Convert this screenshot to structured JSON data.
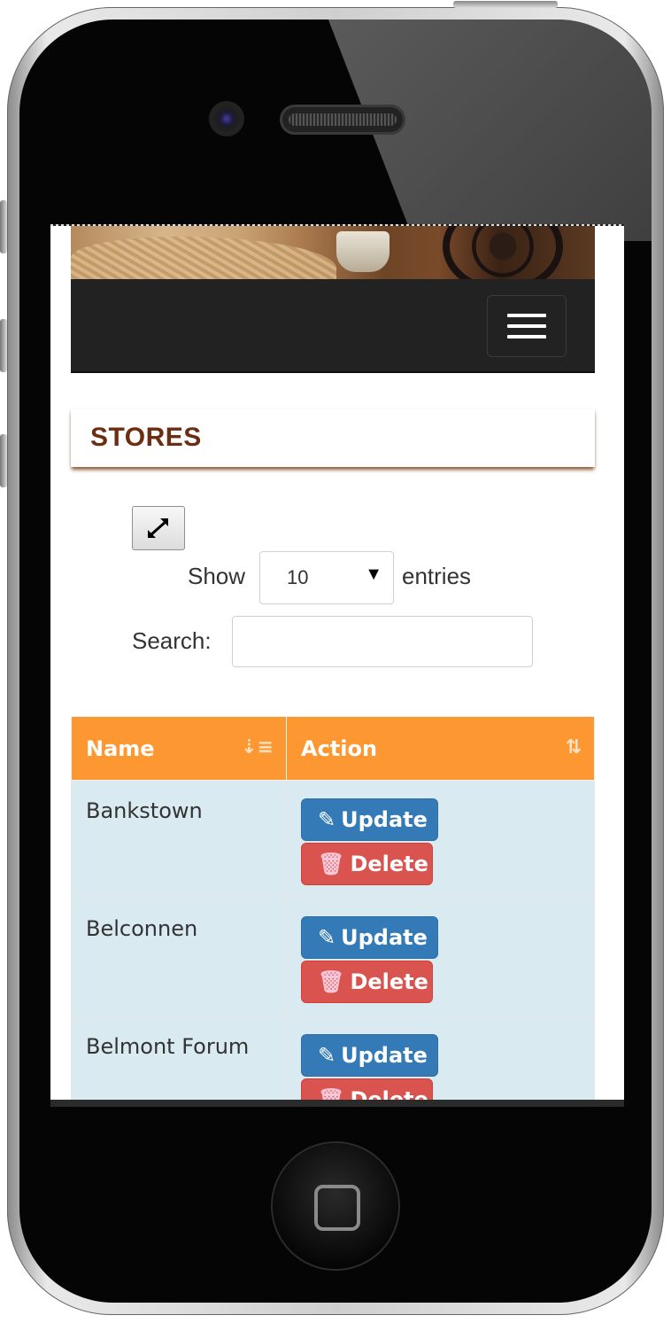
{
  "section": {
    "title": "STORES"
  },
  "length": {
    "show_label": "Show",
    "selected": "10",
    "entries_label": "entries"
  },
  "search": {
    "label": "Search:",
    "value": "",
    "placeholder": ""
  },
  "table": {
    "columns": [
      "Name",
      "Action"
    ],
    "rows": [
      {
        "name": "Bankstown",
        "update": "Update",
        "delete": "Delete"
      },
      {
        "name": "Belconnen",
        "update": "Update",
        "delete": "Delete"
      },
      {
        "name": "Belmont Forum",
        "update": "Update",
        "delete": "Delete"
      }
    ]
  },
  "colors": {
    "header_orange": "#fd9731",
    "row_blue": "#d9eaf1",
    "update_blue": "#337ab7",
    "delete_red": "#d9534f",
    "title_brown": "#6b2e12",
    "navbar": "#222222"
  },
  "icons": {
    "menu": "hamburger-icon",
    "expand": "expand-arrows-icon",
    "name_sort": "sort-alpha-asc-icon",
    "action_sort": "sort-icon",
    "update": "pencil-icon",
    "delete": "trash-icon"
  }
}
